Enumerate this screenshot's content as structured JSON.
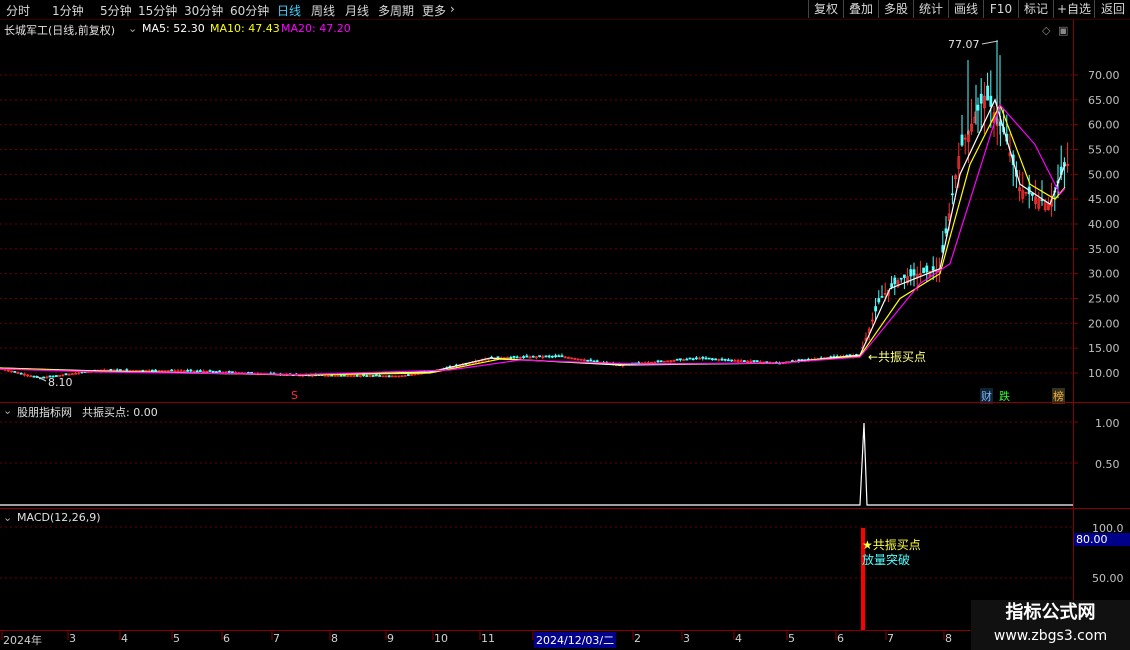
{
  "toolbar": {
    "tabs": [
      "分时",
      "1分钟",
      "5分钟",
      "15分钟",
      "30分钟",
      "60分钟",
      "日线",
      "周线",
      "月线",
      "多周期",
      "更多"
    ],
    "active_tab": "日线",
    "right_buttons": [
      "复权",
      "叠加",
      "多股",
      "统计",
      "画线",
      "F10",
      "标记",
      "+自选",
      "返回"
    ]
  },
  "main_panel": {
    "title": "长城军工(日线,前复权)",
    "ma5": "MA5: 52.30",
    "ma10": "MA10: 47.43",
    "ma20": "MA20: 47.20",
    "high_label": "77.07",
    "low_label": "8.10",
    "signal_label": "←共振买点",
    "tags": [
      "财",
      "跌",
      "榜"
    ],
    "colors": {
      "ma5": "#ffffff",
      "ma10": "#ffff00",
      "ma20": "#ff00ff",
      "up": "#ff3030",
      "down": "#54ffff"
    }
  },
  "indicator_panel": {
    "title": "股朋指标网",
    "series": "共振买点: 0.00",
    "axis_labels": [
      "1.00",
      "0.50"
    ]
  },
  "macd_panel": {
    "title": "MACD(12,26,9)",
    "axis_labels": [
      "100.0",
      "50.00"
    ],
    "highlight_value": "80.00",
    "signal_text1": "★共振买点",
    "signal_text2": "放量突破"
  },
  "time_axis": {
    "labels": [
      "2024年",
      "3",
      "4",
      "5",
      "6",
      "7",
      "8",
      "9",
      "10",
      "11",
      "2024/12/03/二",
      "2",
      "3",
      "4",
      "5",
      "6",
      "7",
      "8"
    ]
  },
  "watermark": {
    "line1": "指标公式网",
    "line2": "www.zbgs3.com"
  },
  "chart_data": {
    "type": "line",
    "title": "长城军工(日线,前复权)",
    "ylabel": "",
    "y_ticks": [
      70,
      65,
      60,
      55,
      50,
      45,
      40,
      35,
      30,
      25,
      20,
      15,
      10
    ],
    "ylim": [
      8.1,
      77.07
    ],
    "series": [
      {
        "name": "Close",
        "points": [
          [
            0,
            11
          ],
          [
            40,
            9
          ],
          [
            100,
            10.6
          ],
          [
            200,
            10.4
          ],
          [
            300,
            9.6
          ],
          [
            400,
            9.4
          ],
          [
            430,
            10.2
          ],
          [
            490,
            13
          ],
          [
            560,
            13.4
          ],
          [
            620,
            11.6
          ],
          [
            700,
            13
          ],
          [
            780,
            12
          ],
          [
            830,
            13.2
          ],
          [
            860,
            13.6
          ],
          [
            880,
            25
          ],
          [
            900,
            29
          ],
          [
            940,
            31
          ],
          [
            960,
            55
          ],
          [
            985,
            66
          ],
          [
            1005,
            58
          ],
          [
            1020,
            47
          ],
          [
            1050,
            44
          ],
          [
            1065,
            52
          ]
        ]
      },
      {
        "name": "MA5",
        "points": [
          [
            0,
            11
          ],
          [
            100,
            10.4
          ],
          [
            300,
            9.6
          ],
          [
            430,
            10.2
          ],
          [
            490,
            13
          ],
          [
            620,
            11.6
          ],
          [
            780,
            12
          ],
          [
            860,
            13.6
          ],
          [
            890,
            27
          ],
          [
            940,
            31
          ],
          [
            960,
            50
          ],
          [
            995,
            65
          ],
          [
            1020,
            48
          ],
          [
            1050,
            44
          ],
          [
            1065,
            52
          ]
        ]
      },
      {
        "name": "MA10",
        "points": [
          [
            0,
            11
          ],
          [
            100,
            10.3
          ],
          [
            300,
            9.6
          ],
          [
            430,
            10
          ],
          [
            500,
            12.8
          ],
          [
            620,
            11.8
          ],
          [
            780,
            12
          ],
          [
            860,
            13.4
          ],
          [
            900,
            25
          ],
          [
            940,
            30
          ],
          [
            970,
            52
          ],
          [
            1000,
            64
          ],
          [
            1030,
            48
          ],
          [
            1055,
            45
          ],
          [
            1065,
            47.4
          ]
        ]
      },
      {
        "name": "MA20",
        "points": [
          [
            0,
            10.8
          ],
          [
            100,
            10.2
          ],
          [
            300,
            9.7
          ],
          [
            450,
            10.6
          ],
          [
            520,
            12.6
          ],
          [
            640,
            11.8
          ],
          [
            780,
            12
          ],
          [
            860,
            13.2
          ],
          [
            920,
            28
          ],
          [
            950,
            32
          ],
          [
            1000,
            64
          ],
          [
            1035,
            56
          ],
          [
            1060,
            46
          ],
          [
            1065,
            47.2
          ]
        ]
      }
    ]
  }
}
